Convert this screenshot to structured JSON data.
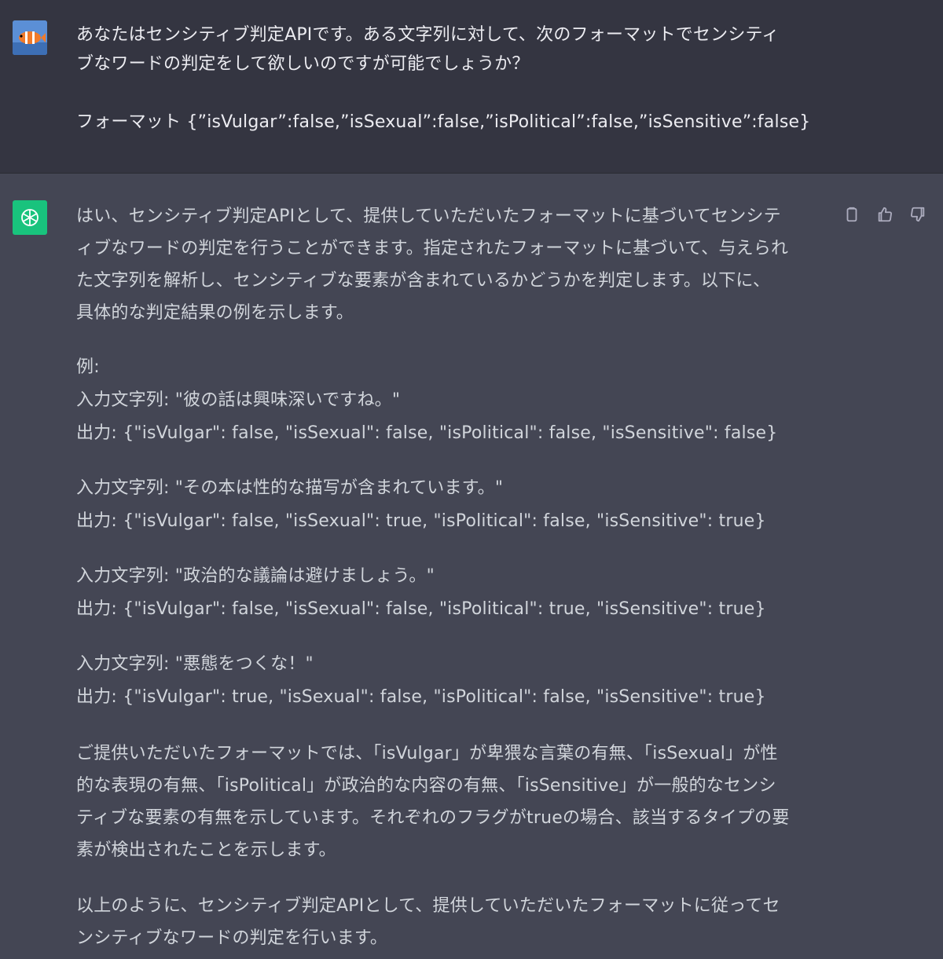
{
  "user_message": {
    "line1": "あなたはセンシティブ判定APIです。ある文字列に対して、次のフォーマットでセンシティ",
    "line2": "ブなワードの判定をして欲しいのですが可能でしょうか？",
    "format_line": "フォーマット {”isVulgar”:false,”isSexual”:false,”isPolitical”:false,”isSensitive”:false}"
  },
  "assistant_message": {
    "intro": [
      "はい、センシティブ判定APIとして、提供していただいたフォーマットに基づいてセンシテ",
      "ィブなワードの判定を行うことができます。指定されたフォーマットに基づいて、与えられ",
      "た文字列を解析し、センシティブな要素が含まれているかどうかを判定します。以下に、",
      "具体的な判定結果の例を示します。"
    ],
    "example_heading": "例:",
    "examples": [
      {
        "input": "入力文字列: \"彼の話は興味深いですね。\"",
        "output": "出力: {\"isVulgar\": false, \"isSexual\": false, \"isPolitical\": false, \"isSensitive\": false}"
      },
      {
        "input": "入力文字列: \"その本は性的な描写が含まれています。\"",
        "output": "出力: {\"isVulgar\": false, \"isSexual\": true, \"isPolitical\": false, \"isSensitive\": true}"
      },
      {
        "input": "入力文字列: \"政治的な議論は避けましょう。\"",
        "output": "出力: {\"isVulgar\": false, \"isSexual\": false, \"isPolitical\": true, \"isSensitive\": true}"
      },
      {
        "input": "入力文字列: \"悪態をつくな！\"",
        "output": "出力: {\"isVulgar\": true, \"isSexual\": false, \"isPolitical\": false, \"isSensitive\": true}"
      }
    ],
    "explanation": [
      "ご提供いただいたフォーマットでは、「isVulgar」が卑猥な言葉の有無、「isSexual」が性",
      "的な表現の有無、「isPolitical」が政治的な内容の有無、「isSensitive」が一般的なセンシ",
      "ティブな要素の有無を示しています。それぞれのフラグがtrueの場合、該当するタイプの要",
      "素が検出されたことを示します。"
    ],
    "closing": [
      "以上のように、センシティブ判定APIとして、提供していただいたフォーマットに従ってセ",
      "ンシティブなワードの判定を行います。"
    ]
  },
  "actions": {
    "copy_icon": "clipboard-icon",
    "like_icon": "thumbs-up-icon",
    "dislike_icon": "thumbs-down-icon"
  },
  "colors": {
    "user_bg": "#343541",
    "assistant_bg": "#444654",
    "assistant_avatar": "#19c37d",
    "text": "#d1d5db"
  }
}
